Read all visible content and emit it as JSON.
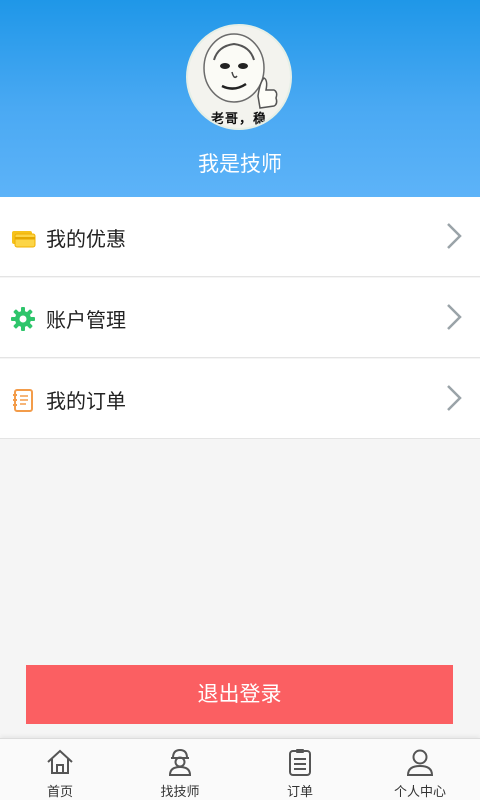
{
  "profile": {
    "avatar_caption": "老哥，稳",
    "username": "我是技师"
  },
  "menu": {
    "items": [
      {
        "label": "我的优惠",
        "icon": "coupon-card-icon",
        "icon_color": "#f6c21b"
      },
      {
        "label": "账户管理",
        "icon": "gear-icon",
        "icon_color": "#2ec56b"
      },
      {
        "label": "我的订单",
        "icon": "order-notebook-icon",
        "icon_color": "#f39c4a"
      }
    ]
  },
  "logout": {
    "label": "退出登录",
    "color": "#fb5f62"
  },
  "tabbar": {
    "items": [
      {
        "label": "首页",
        "icon": "home-icon"
      },
      {
        "label": "找技师",
        "icon": "technician-icon"
      },
      {
        "label": "订单",
        "icon": "clipboard-icon"
      },
      {
        "label": "个人中心",
        "icon": "user-icon"
      }
    ]
  },
  "colors": {
    "header_top": "#1f97e8",
    "header_bottom": "#5db3f8",
    "background": "#f5f5f5"
  }
}
